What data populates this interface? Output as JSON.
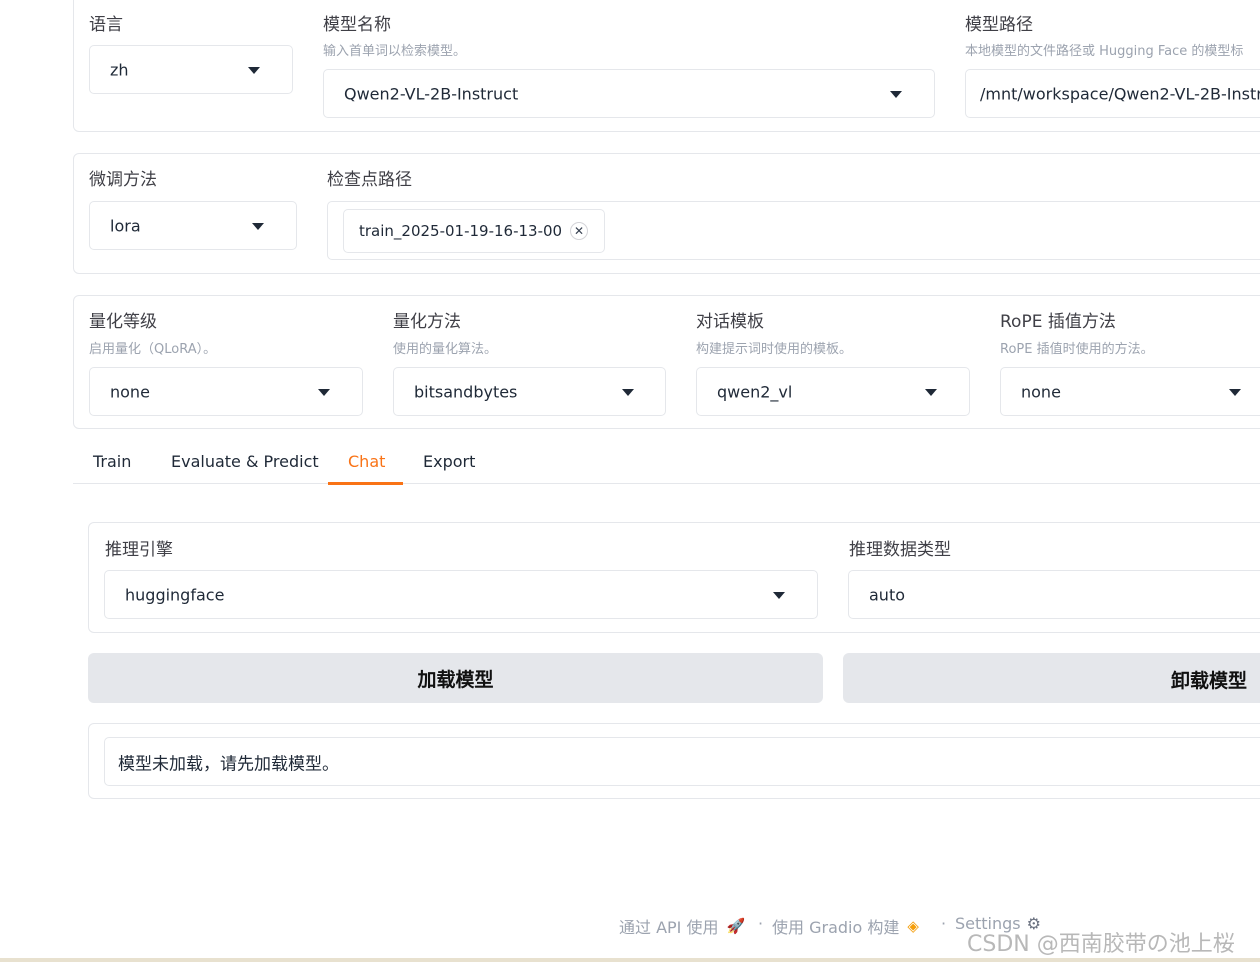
{
  "row1": {
    "language": {
      "label": "语言",
      "value": "zh"
    },
    "model_name": {
      "label": "模型名称",
      "hint": "输入首单词以检索模型。",
      "value": "Qwen2-VL-2B-Instruct"
    },
    "model_path": {
      "label": "模型路径",
      "hint": "本地模型的文件路径或 Hugging Face 的模型标",
      "value": "/mnt/workspace/Qwen2-VL-2B-Instru"
    }
  },
  "row2": {
    "finetune": {
      "label": "微调方法",
      "value": "lora"
    },
    "checkpoint": {
      "label": "检查点路径",
      "chip": "train_2025-01-19-16-13-00"
    }
  },
  "row3": {
    "quant_bit": {
      "label": "量化等级",
      "hint": "启用量化（QLoRA）。",
      "value": "none"
    },
    "quant_method": {
      "label": "量化方法",
      "hint": "使用的量化算法。",
      "value": "bitsandbytes"
    },
    "template": {
      "label": "对话模板",
      "hint": "构建提示词时使用的模板。",
      "value": "qwen2_vl"
    },
    "rope": {
      "label": "RoPE 插值方法",
      "hint": "RoPE 插值时使用的方法。",
      "value": "none"
    }
  },
  "tabs": [
    "Train",
    "Evaluate & Predict",
    "Chat",
    "Export"
  ],
  "chat": {
    "infer_backend": {
      "label": "推理引擎",
      "value": "huggingface"
    },
    "infer_dtype": {
      "label": "推理数据类型",
      "value": "auto"
    },
    "load_button": "加载模型",
    "unload_button": "卸载模型",
    "status": "模型未加载，请先加载模型。"
  },
  "footer": {
    "api": "通过 API 使用",
    "gradio": "使用 Gradio 构建",
    "settings": "Settings",
    "sep": "·"
  },
  "watermark": "CSDN @西南胶带の池上桜",
  "colors": {
    "accent": "#f97316",
    "button_bg": "#e5e7eb",
    "border": "#e5e7eb"
  }
}
